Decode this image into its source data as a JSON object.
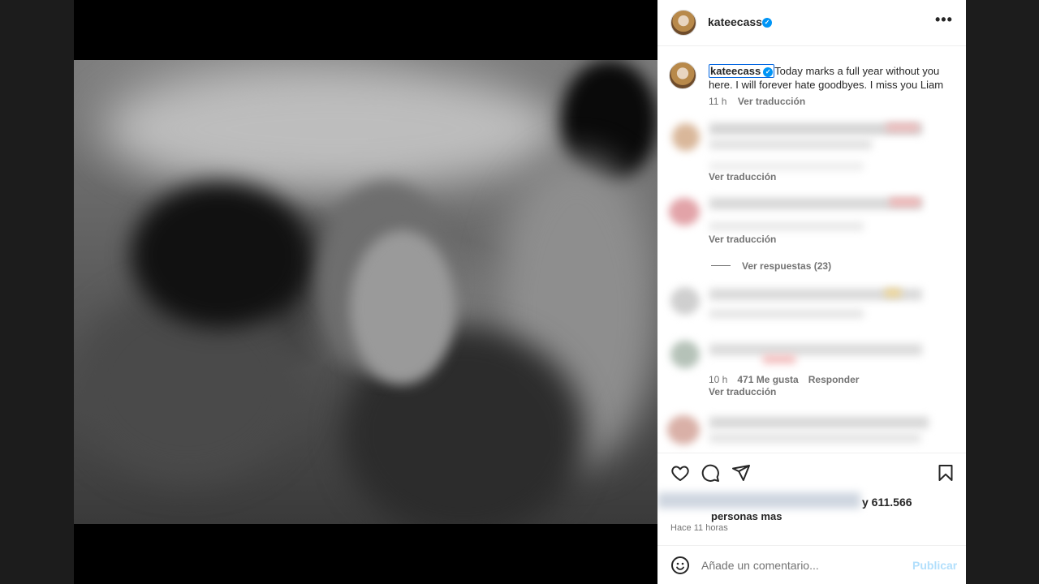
{
  "post": {
    "username": "kateecass",
    "verified_glyph": "✓",
    "caption": "Today marks a full year without you here. I will forever hate goodbyes. I miss you Liam",
    "caption_time": "11 h",
    "translate_label": "Ver traducción"
  },
  "comments": [
    {
      "translate_label": "Ver traducción"
    },
    {
      "translate_label": "Ver traducción",
      "replies_label": "Ver respuestas (23)"
    },
    {},
    {
      "time": "10 h",
      "likes": "471 Me gusta",
      "reply_label": "Responder",
      "translate_label": "Ver traducción"
    },
    {}
  ],
  "actions": {
    "like_icon": "heart-icon",
    "comment_icon": "comment-icon",
    "share_icon": "share-icon",
    "save_icon": "bookmark-icon"
  },
  "likes": {
    "count_text": "y 611.566",
    "others_text": "personas mas"
  },
  "time_ago": "Hace 11 horas",
  "comment_box": {
    "placeholder": "Añade un comentario...",
    "post_label": "Publicar"
  },
  "colors": {
    "accent": "#0095f6",
    "post_button_disabled": "#b2dffc",
    "backdrop": "#1c1c1c"
  }
}
